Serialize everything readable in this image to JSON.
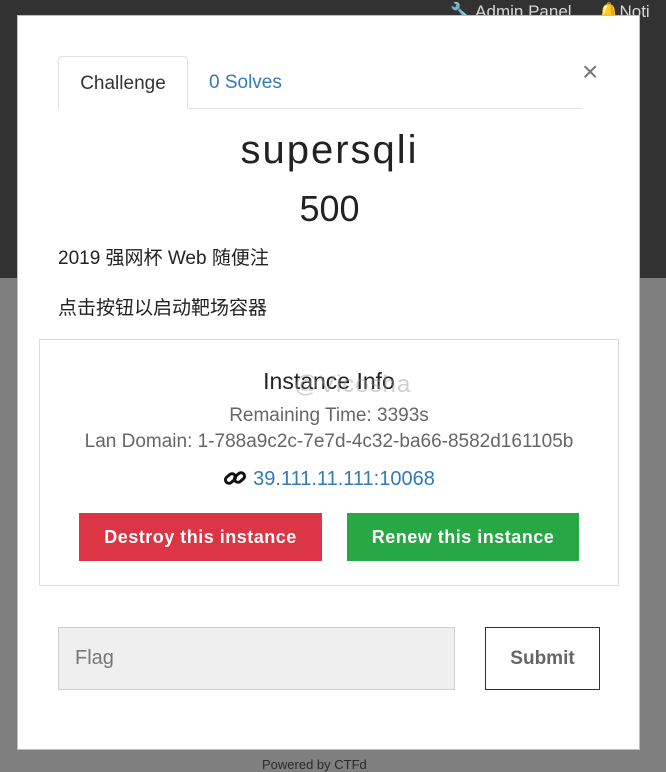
{
  "background": {
    "nav": {
      "admin_panel": "Admin Panel",
      "notifications": "Noti"
    },
    "footer": "Powered by CTFd"
  },
  "modal": {
    "close_symbol": "×",
    "tabs": [
      {
        "label": "Challenge",
        "active": true
      },
      {
        "label": "0 Solves",
        "active": false
      }
    ],
    "challenge": {
      "name": "supersqli",
      "points": "500",
      "description": "2019 强网杯 Web 随便注",
      "hint": "点击按钮以启动靶场容器"
    },
    "instance": {
      "title": "Instance Info",
      "watermark": "@Vicosha",
      "remaining_time": "Remaining Time: 3393s",
      "lan_domain": "Lan Domain: 1-788a9c2c-7e7d-4c32-ba66-8582d161105b",
      "address": "39.111.11.111:10068",
      "destroy_label": "Destroy this instance",
      "renew_label": "Renew this instance"
    },
    "flag": {
      "placeholder": "Flag",
      "value": ""
    },
    "submit_label": "Submit"
  },
  "colors": {
    "destroy": "#dc3545",
    "renew": "#28a745",
    "link": "#337ab7"
  },
  "icons": {
    "close": "close-icon",
    "link": "link-icon",
    "wrench": "wrench-icon",
    "bell": "bell-icon"
  }
}
